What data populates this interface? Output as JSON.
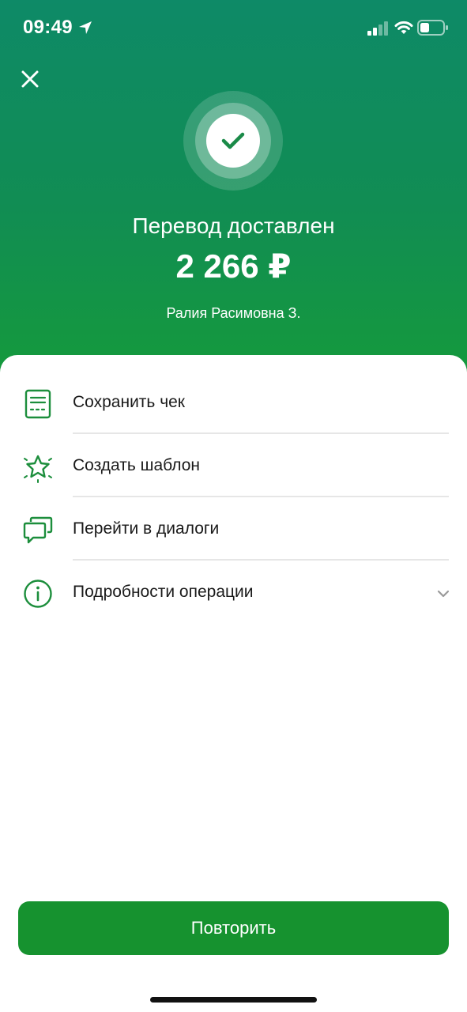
{
  "status_bar": {
    "time": "09:49",
    "location_icon": "location-arrow-icon",
    "signal_icon": "cellular-signal-icon",
    "wifi_icon": "wifi-icon",
    "battery_icon": "battery-icon"
  },
  "header": {
    "close_icon": "close-icon",
    "success_icon": "check-icon",
    "title": "Перевод доставлен",
    "amount": "2 266 ₽",
    "recipient": "Ралия Расимовна З."
  },
  "actions": [
    {
      "label": "Сохранить чек",
      "icon": "receipt-icon"
    },
    {
      "label": "Создать шаблон",
      "icon": "star-icon"
    },
    {
      "label": "Перейти в диалоги",
      "icon": "chat-bubbles-icon"
    },
    {
      "label": "Подробности операции",
      "icon": "info-icon",
      "trailing_icon": "chevron-down-icon"
    }
  ],
  "footer": {
    "repeat_label": "Повторить"
  },
  "colors": {
    "brand_green": "#16922f",
    "header_gradient_top": "#0e8a67",
    "header_gradient_bottom": "#159a3c",
    "icon_green": "#1c8e3c",
    "divider": "#e6e6e6",
    "text": "#1a1a1a"
  }
}
